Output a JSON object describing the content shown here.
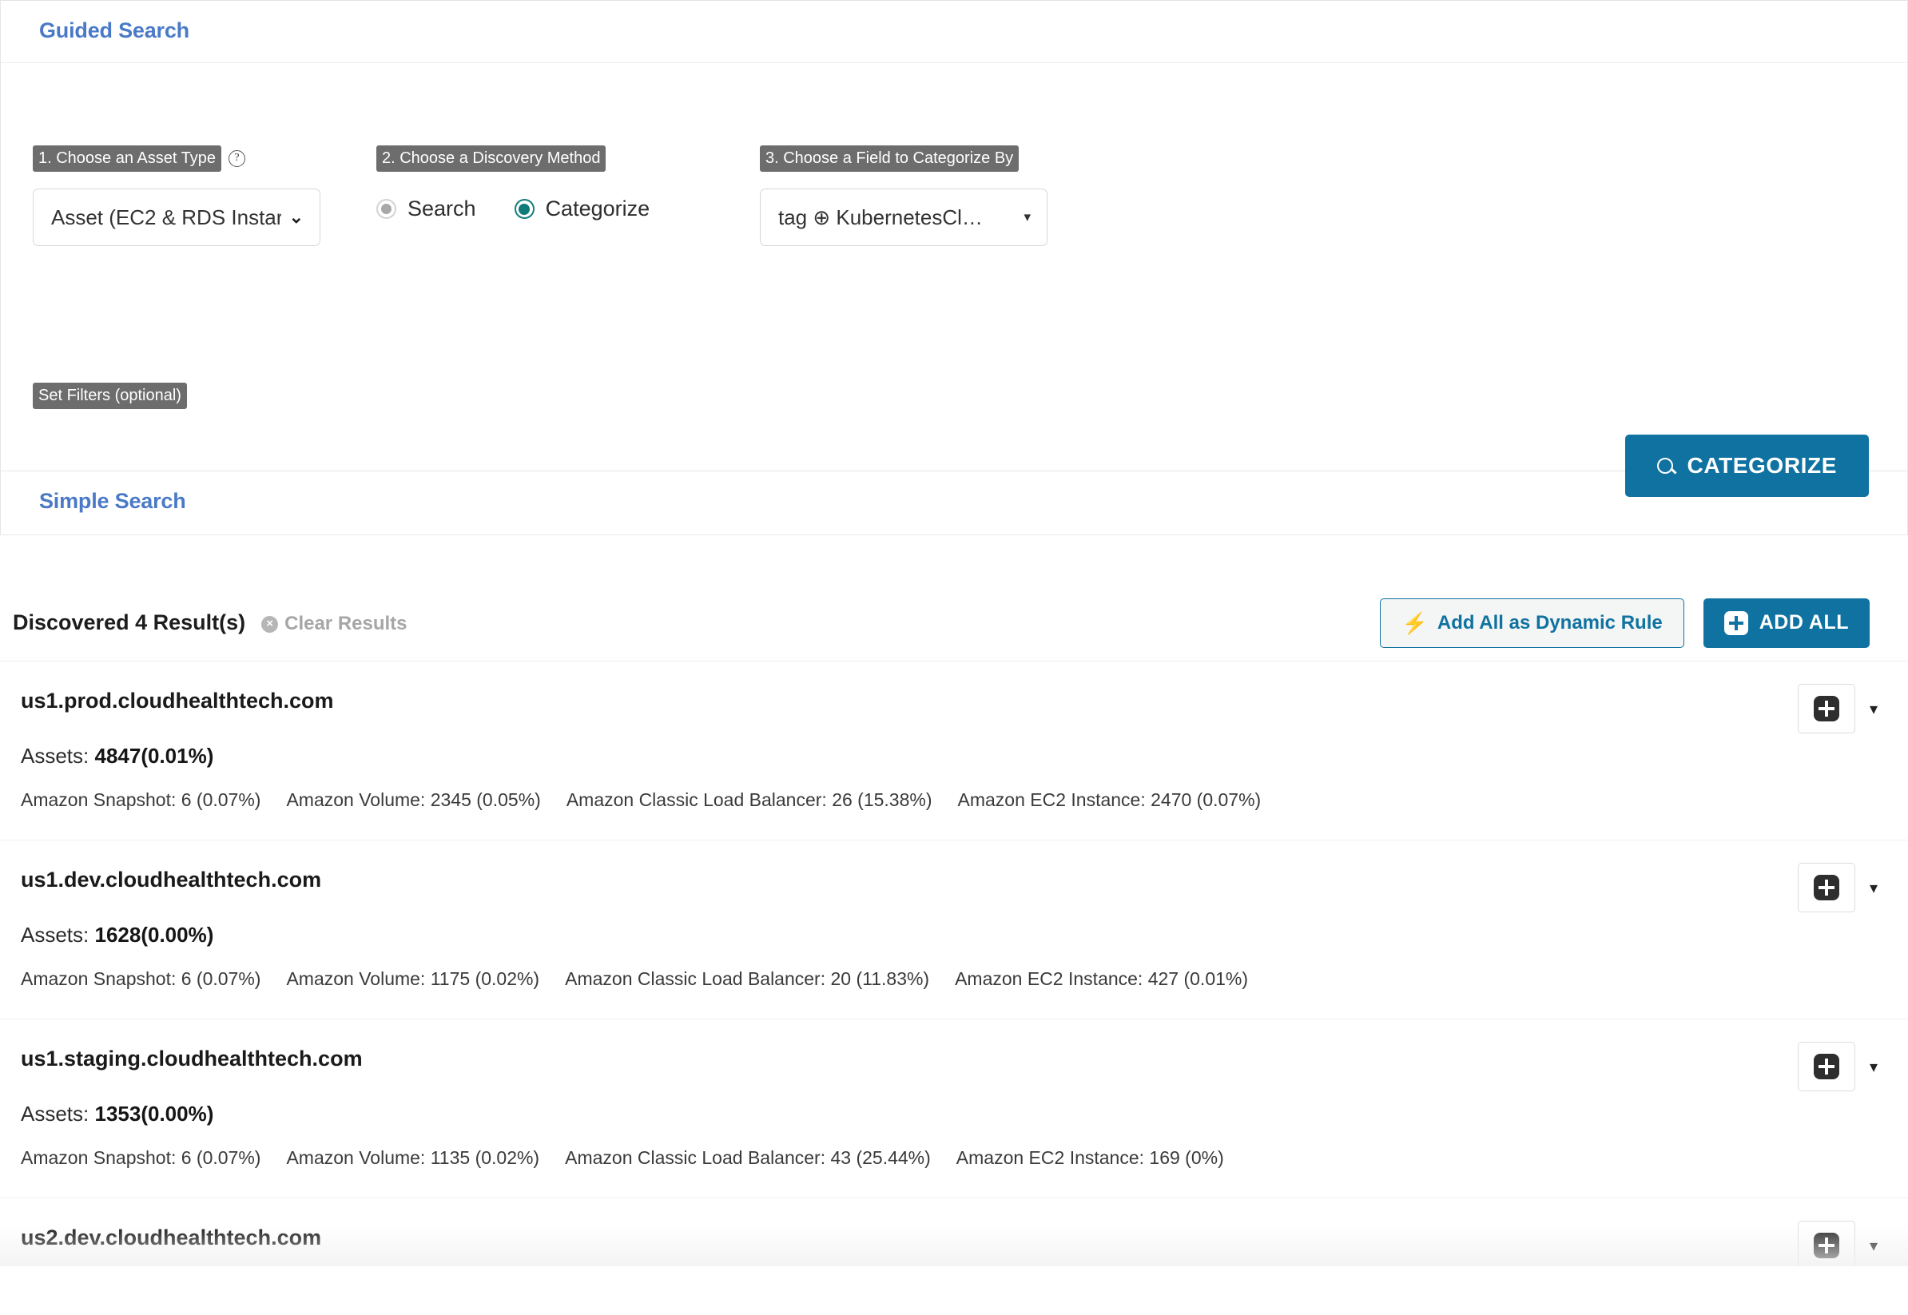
{
  "guided": {
    "title": "Guided Search",
    "step1": {
      "label": "1. Choose an Asset Type",
      "help_glyph": "?",
      "selected": "Asset (EC2 & RDS Instar",
      "caret": "⌄"
    },
    "step2": {
      "label": "2. Choose a Discovery Method",
      "options": [
        {
          "label": "Search",
          "selected": false
        },
        {
          "label": "Categorize",
          "selected": true
        }
      ]
    },
    "step3": {
      "label": "3. Choose a Field to Categorize By",
      "selected": "tag ⊕ KubernetesCl…",
      "caret": "▾"
    },
    "filters_label": "Set Filters (optional)",
    "categorize_button": "CATEGORIZE",
    "categorize_icon": "search-icon"
  },
  "simple": {
    "title": "Simple Search"
  },
  "results": {
    "count_label": "Discovered 4 Result(s)",
    "clear_label": "Clear Results",
    "clear_icon": "x-circle-icon",
    "dynamic_rule_button": "Add All as Dynamic Rule",
    "dynamic_rule_icon": "⚡",
    "add_all_button": "ADD ALL",
    "assets_prefix": "Assets: ",
    "add_icon": "plus-icon",
    "caret": "▾",
    "rows": [
      {
        "host": "us1.prod.cloudhealthtech.com",
        "assets": "4847(0.01%)",
        "breakdown": [
          "Amazon Snapshot: 6 (0.07%)",
          "Amazon Volume: 2345 (0.05%)",
          "Amazon Classic Load Balancer: 26 (15.38%)",
          "Amazon EC2 Instance: 2470 (0.07%)"
        ]
      },
      {
        "host": "us1.dev.cloudhealthtech.com",
        "assets": "1628(0.00%)",
        "breakdown": [
          "Amazon Snapshot: 6 (0.07%)",
          "Amazon Volume: 1175 (0.02%)",
          "Amazon Classic Load Balancer: 20 (11.83%)",
          "Amazon EC2 Instance: 427 (0.01%)"
        ]
      },
      {
        "host": "us1.staging.cloudhealthtech.com",
        "assets": "1353(0.00%)",
        "breakdown": [
          "Amazon Snapshot: 6 (0.07%)",
          "Amazon Volume: 1135 (0.02%)",
          "Amazon Classic Load Balancer: 43 (25.44%)",
          "Amazon EC2 Instance: 169 (0%)"
        ]
      },
      {
        "host": "us2.dev.cloudhealthtech.com",
        "assets": "",
        "breakdown": []
      }
    ]
  },
  "colors": {
    "accent_blue": "#0f72a0",
    "title_blue": "#4a7ac7",
    "chip_gray": "#6d6d6d",
    "radio_teal": "#0f7b7b"
  }
}
